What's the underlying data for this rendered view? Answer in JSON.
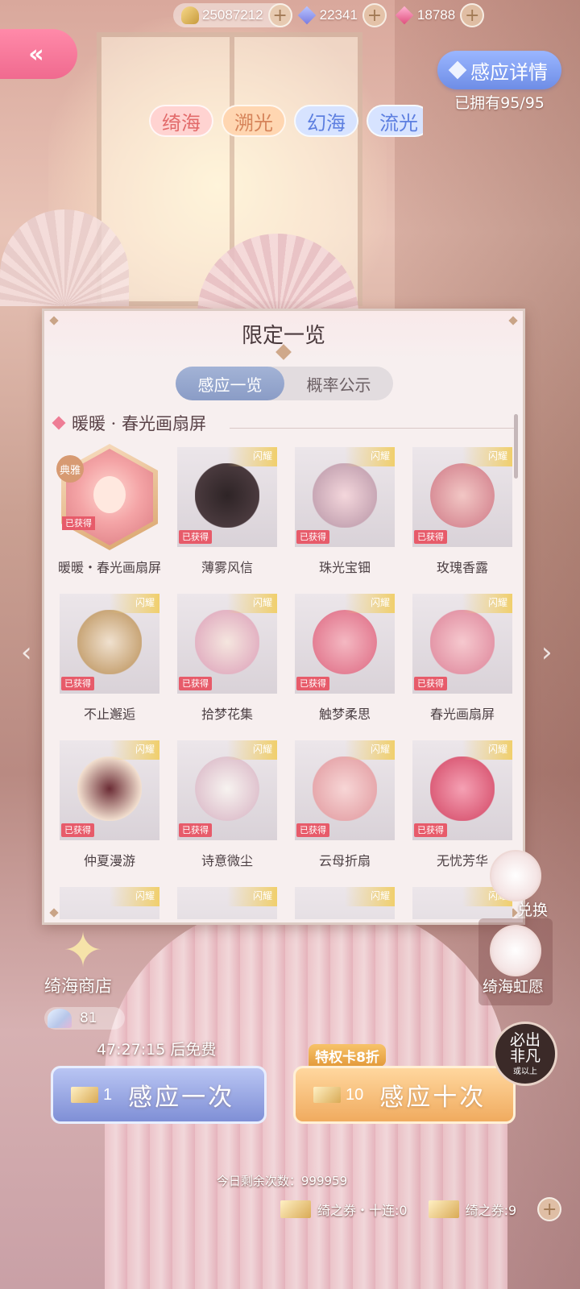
{
  "currency": {
    "gold": "25087212",
    "diamond": "22341",
    "pink_diamond": "18788"
  },
  "header": {
    "back_icon": "double-chevron-left-icon",
    "detail_label": "感应详情",
    "owned_text": "已拥有95/95"
  },
  "pool_tabs": [
    "绮海",
    "溯光",
    "幻海",
    "流光"
  ],
  "panel": {
    "title": "限定一览",
    "tabs": [
      "感应一览",
      "概率公示"
    ],
    "section_title": "暖暖 · 春光画扇屏",
    "rarity_tag": "闪耀",
    "obtained_badge": "已获得",
    "featured_tag": "典雅",
    "items": [
      {
        "name": "暖暖・春光画扇屏"
      },
      {
        "name": "薄雾风信"
      },
      {
        "name": "珠光宝钿"
      },
      {
        "name": "玫瑰香露"
      },
      {
        "name": "不止邂逅"
      },
      {
        "name": "拾梦花集"
      },
      {
        "name": "触梦柔思"
      },
      {
        "name": "春光画扇屏"
      },
      {
        "name": "仲夏漫游"
      },
      {
        "name": "诗意微尘"
      },
      {
        "name": "云母折扇"
      },
      {
        "name": "无忧芳华"
      }
    ]
  },
  "side": {
    "exchange_label": "兑换",
    "wish_label": "绮海虹愿"
  },
  "shop": {
    "title": "绮海商店",
    "shell_count": "81"
  },
  "timer_text": "47:27:15 后免费",
  "draw_one": {
    "count": "1",
    "label": "感应一次"
  },
  "draw_ten": {
    "count": "10",
    "label": "感应十次",
    "discount": "特权卡8折"
  },
  "must_badge": {
    "main": "必出非凡",
    "sub": "或以上"
  },
  "remaining_text": "今日剩余次数：999959",
  "tickets": {
    "ten_label": "绮之券・十连:0",
    "single_label": "绮之券:9"
  }
}
